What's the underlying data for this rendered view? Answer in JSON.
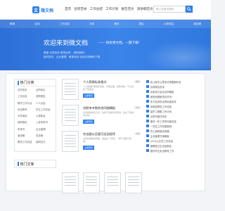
{
  "brand": {
    "logo_glyph": "文",
    "name": "微文档"
  },
  "nav": [
    "首页",
    "合同范本",
    "工作总结",
    "工作计划",
    "报告范文",
    "演讲稿范文"
  ],
  "search": {
    "placeholder": "输入关键词搜索"
  },
  "hero": {
    "strip": [
      "教案",
      "合同",
      "工作总结",
      "方案",
      "策划",
      "报告",
      "心得体会",
      "演讲稿"
    ],
    "title": "欢迎来到微文档",
    "subtitle": "—— 找优秀文档，一键下载！",
    "line1": "覆盖 合同范本 租赁合同 ，精彩推荐！",
    "line2": "新材发布，企业管理、教育培训 实用文档等你下载"
  },
  "categories": {
    "title": "热门分类",
    "items": [
      "合同范本",
      "合同协议",
      "工作总结",
      "述职报告",
      "教学工作计划",
      "个人总结",
      "安全教育",
      "学生工作总结",
      "开学演讲",
      "心得体会",
      "辞职报告",
      "入党申请书",
      "申请书",
      "企业管理",
      "演讲稿",
      "发言稿",
      "蓄积工作总结",
      "高职范文"
    ]
  },
  "docs": [
    {
      "title": "个人简报标准格式",
      "desc": "个人简报标准格式模板，内容全面，结构清晰，可以直接下载使用。",
      "button": "立即预览",
      "tag": "报告"
    },
    {
      "title": "合肥市寺院的合同细模板",
      "desc": "合同模板样式齐全，适用于各类场景使用，欢迎下载参考文档。",
      "button": "立即预览",
      "tag": "合同"
    },
    {
      "title": "合去跟从至据可还旧程序",
      "desc": "文档内容精选整理，涵盖多个领域，一键下载即可使用。",
      "button": "立即预览",
      "tag": "文档"
    }
  ],
  "list": [
    "幼儿园中心里全位情图案利全",
    "合同报告范本",
    "买卖双方会议合同模板",
    "我的房屋租赁合同书",
    "关于培训的合同标准范本",
    "你就感恩的工作总结",
    "保护工期限工作计划",
    "合同书格式范本",
    "做好一年工作的年度总结",
    "一次性工作完整案例",
    "员工辞职报告表格",
    "企业管理方案模板",
    "2014公业员工作总结",
    "度教园卫生实验报告",
    "做好学生安全教育工作"
  ],
  "hot": {
    "title": "热门文库"
  }
}
